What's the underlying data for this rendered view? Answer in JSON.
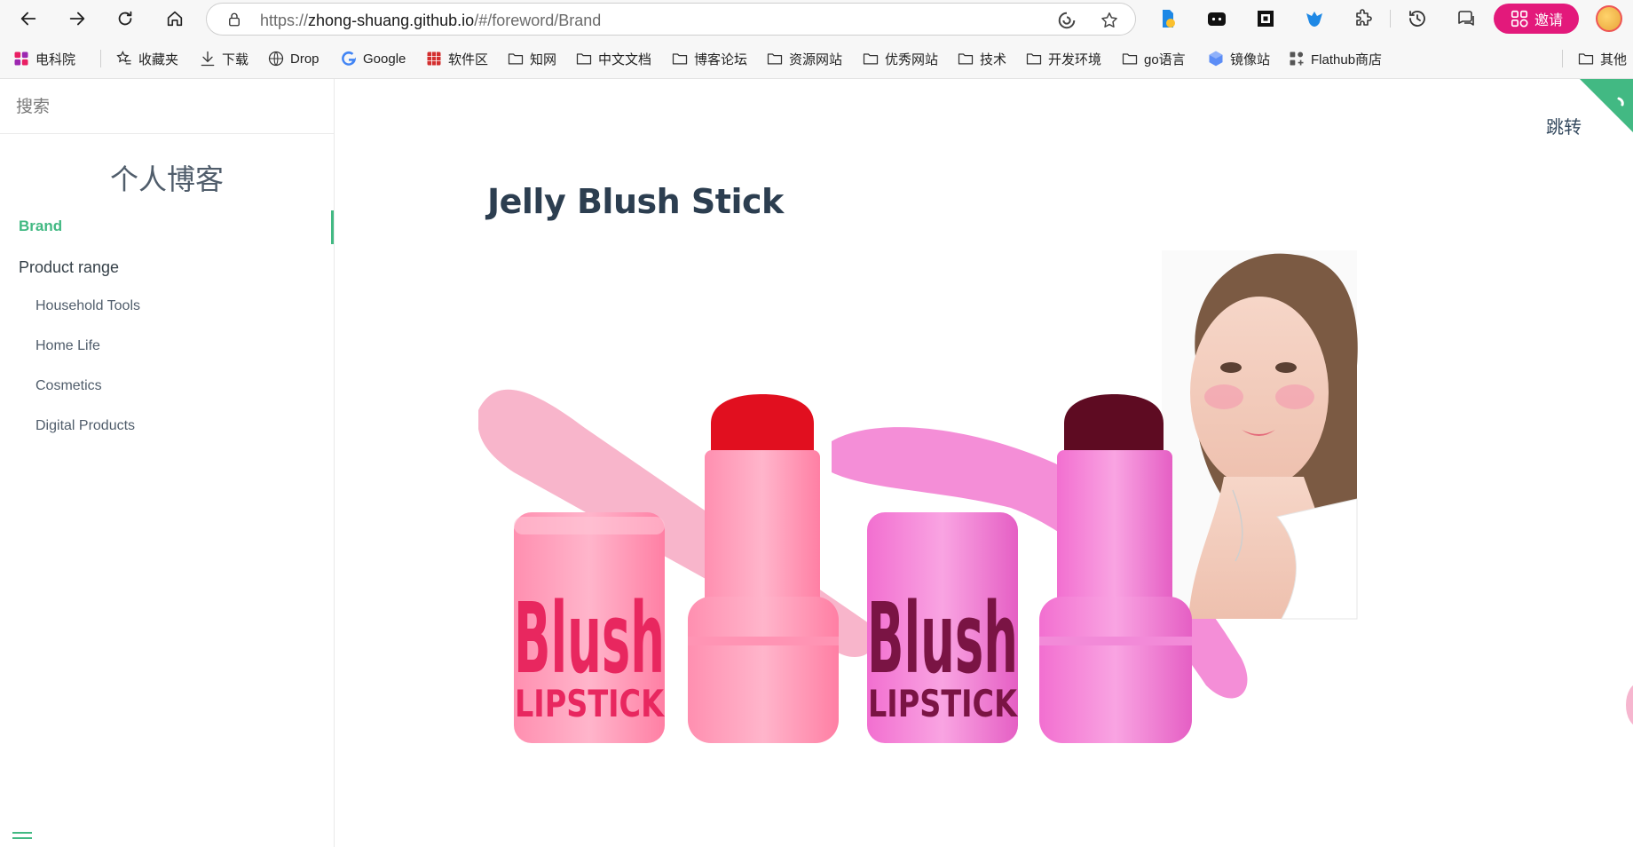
{
  "browser": {
    "url_scheme": "https://",
    "url_host": "zhong-shuang.github.io",
    "url_path": "/#/foreword/Brand",
    "invite_label": "邀请"
  },
  "bookmarks": [
    {
      "label": "电科院",
      "icon": "app-grid-icon"
    },
    {
      "label": "收藏夹",
      "icon": "star-list-icon"
    },
    {
      "label": "下载",
      "icon": "download-icon"
    },
    {
      "label": "Drop",
      "icon": "globe-icon"
    },
    {
      "label": "Google",
      "icon": "google-icon"
    },
    {
      "label": "软件区",
      "icon": "red-grid-icon"
    },
    {
      "label": "知网",
      "icon": "folder-icon"
    },
    {
      "label": "中文文档",
      "icon": "folder-icon"
    },
    {
      "label": "博客论坛",
      "icon": "folder-icon"
    },
    {
      "label": "资源网站",
      "icon": "folder-icon"
    },
    {
      "label": "优秀网站",
      "icon": "folder-icon"
    },
    {
      "label": "技术",
      "icon": "folder-icon"
    },
    {
      "label": "开发环境",
      "icon": "folder-icon"
    },
    {
      "label": "go语言",
      "icon": "folder-icon"
    },
    {
      "label": "镜像站",
      "icon": "cube-icon"
    },
    {
      "label": "Flathub商店",
      "icon": "flathub-icon"
    },
    {
      "label": "其他",
      "icon": "folder-icon"
    }
  ],
  "sidebar": {
    "search_placeholder": "搜索",
    "app_name": "个人博客",
    "active_item": "Brand",
    "section_label": "Product range",
    "sub_items": [
      "Household Tools",
      "Home Life",
      "Cosmetics",
      "Digital Products"
    ]
  },
  "main": {
    "jump_label": "跳转",
    "title": "Jelly Blush Stick",
    "product_image": {
      "word_top": "Blush",
      "word_bottom": "LIPSTICK"
    }
  },
  "colors": {
    "accent": "#42b983",
    "invite": "#e3197b",
    "title": "#2c3e50"
  }
}
